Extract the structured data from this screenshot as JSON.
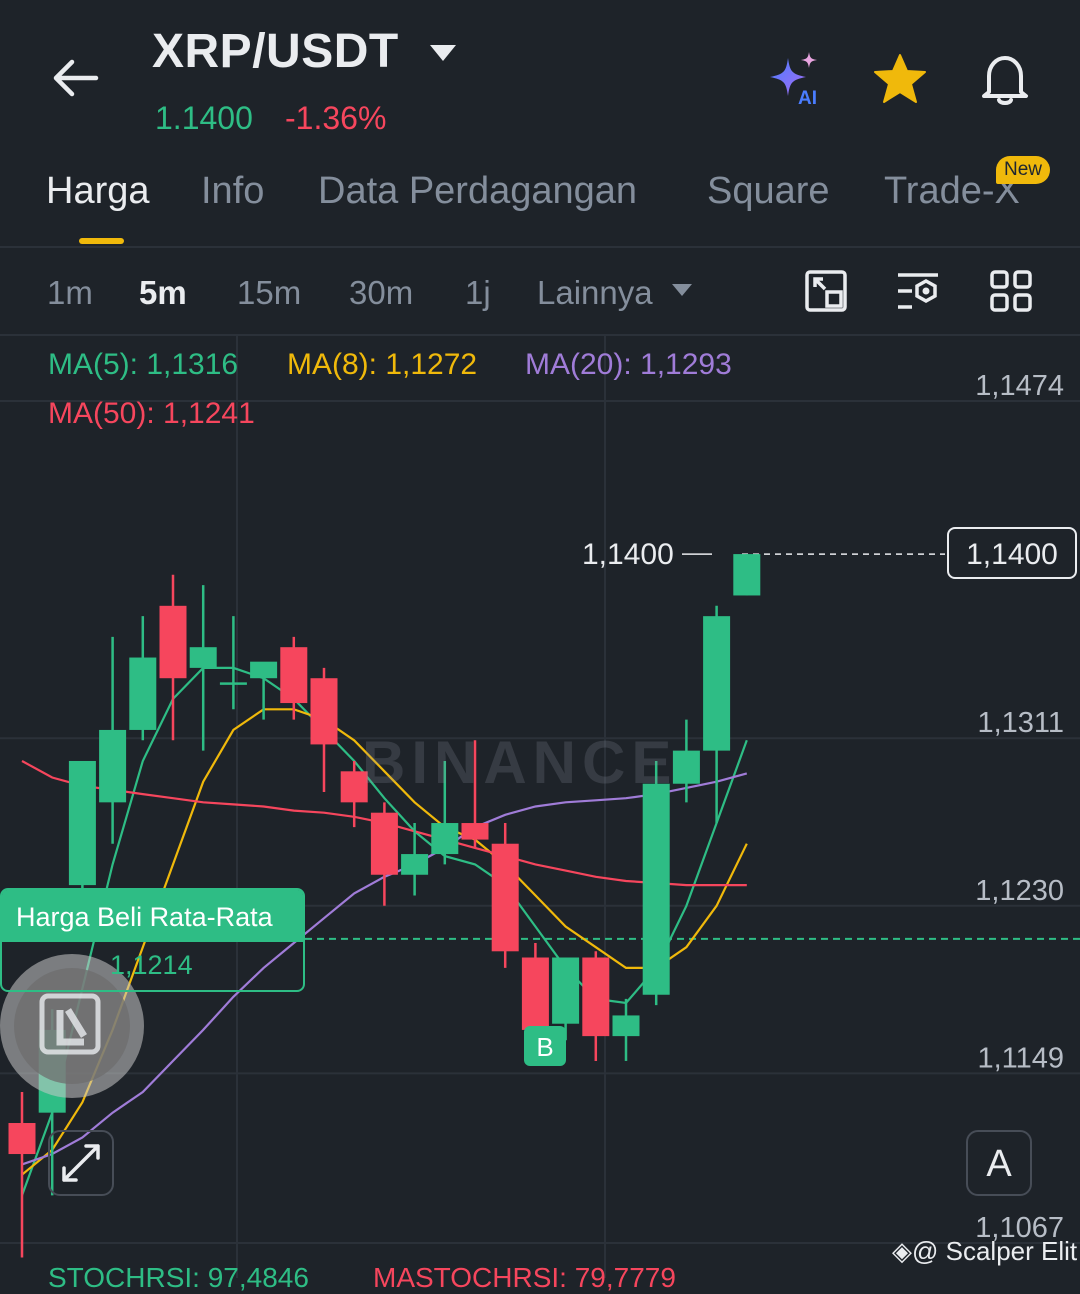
{
  "header": {
    "pair": "XRP/USDT",
    "price": "1.1400",
    "change": "-1.36%",
    "icons": [
      "back-arrow-icon",
      "ai-sparkle-icon",
      "star-icon",
      "bell-icon"
    ],
    "ai_label": "AI"
  },
  "tabs": [
    {
      "label": "Harga",
      "active": true
    },
    {
      "label": "Info",
      "active": false
    },
    {
      "label": "Data Perdagangan",
      "active": false
    },
    {
      "label": "Square",
      "active": false
    },
    {
      "label": "Trade-X",
      "active": false
    }
  ],
  "new_badge": "New",
  "intervals": [
    {
      "label": "1m",
      "active": false
    },
    {
      "label": "5m",
      "active": true
    },
    {
      "label": "15m",
      "active": false
    },
    {
      "label": "30m",
      "active": false
    },
    {
      "label": "1j",
      "active": false
    },
    {
      "label": "Lainnya",
      "active": false
    }
  ],
  "tools": [
    "chart-layout-icon",
    "indicator-settings-icon",
    "grid-view-icon"
  ],
  "ma_legend": [
    {
      "label": "MA(5): 1,1316",
      "color": "#2ebd85"
    },
    {
      "label": "MA(8): 1,1272",
      "color": "#f0b90b"
    },
    {
      "label": "MA(20): 1,1293",
      "color": "#a07cd8"
    },
    {
      "label": "MA(50): 1,1241",
      "color": "#f6465d"
    }
  ],
  "current_price_label": "1,1400",
  "average_buy": {
    "title": "Harga Beli Rata-Rata",
    "value": "1,1214"
  },
  "buy_marker": "B",
  "watermark": "BINANCE",
  "font_button": "A",
  "stoch": {
    "left": "STOCHRSI: 97,4846",
    "right": "MASTOCHRSI: 79,7779"
  },
  "credit": "@ Scalper Elit",
  "chart_data": {
    "type": "candlestick",
    "ylim": [
      1.103,
      1.153
    ],
    "y_ticks": [
      "1,1474",
      "1,1311",
      "1,1230",
      "1,1149",
      "1,1067"
    ],
    "y_tick_values": [
      1.1474,
      1.1311,
      1.123,
      1.1149,
      1.1067
    ],
    "last_price": 1.14,
    "avg_buy_price": 1.1214,
    "candles": [
      {
        "o": 1.1125,
        "h": 1.114,
        "l": 1.106,
        "c": 1.111
      },
      {
        "o": 1.113,
        "h": 1.118,
        "l": 1.109,
        "c": 1.117
      },
      {
        "o": 1.124,
        "h": 1.13,
        "l": 1.122,
        "c": 1.13
      },
      {
        "o": 1.128,
        "h": 1.136,
        "l": 1.126,
        "c": 1.1315
      },
      {
        "o": 1.1315,
        "h": 1.137,
        "l": 1.131,
        "c": 1.135
      },
      {
        "o": 1.1375,
        "h": 1.139,
        "l": 1.131,
        "c": 1.134
      },
      {
        "o": 1.1345,
        "h": 1.1385,
        "l": 1.1305,
        "c": 1.1355
      },
      {
        "o": 1.1338,
        "h": 1.137,
        "l": 1.1325,
        "c": 1.1338
      },
      {
        "o": 1.134,
        "h": 1.1345,
        "l": 1.132,
        "c": 1.1348
      },
      {
        "o": 1.1355,
        "h": 1.136,
        "l": 1.132,
        "c": 1.1328
      },
      {
        "o": 1.134,
        "h": 1.1345,
        "l": 1.1285,
        "c": 1.1308
      },
      {
        "o": 1.1295,
        "h": 1.13,
        "l": 1.1268,
        "c": 1.128
      },
      {
        "o": 1.1275,
        "h": 1.128,
        "l": 1.123,
        "c": 1.1245
      },
      {
        "o": 1.1245,
        "h": 1.127,
        "l": 1.1235,
        "c": 1.1255
      },
      {
        "o": 1.1255,
        "h": 1.13,
        "l": 1.125,
        "c": 1.127
      },
      {
        "o": 1.127,
        "h": 1.131,
        "l": 1.1258,
        "c": 1.1262
      },
      {
        "o": 1.126,
        "h": 1.127,
        "l": 1.12,
        "c": 1.1208
      },
      {
        "o": 1.1205,
        "h": 1.1212,
        "l": 1.1165,
        "c": 1.117
      },
      {
        "o": 1.1173,
        "h": 1.1205,
        "l": 1.1165,
        "c": 1.1205
      },
      {
        "o": 1.1205,
        "h": 1.1208,
        "l": 1.1155,
        "c": 1.1167
      },
      {
        "o": 1.1167,
        "h": 1.1185,
        "l": 1.1155,
        "c": 1.1177
      },
      {
        "o": 1.1187,
        "h": 1.13,
        "l": 1.1182,
        "c": 1.1289
      },
      {
        "o": 1.1289,
        "h": 1.132,
        "l": 1.128,
        "c": 1.1305
      },
      {
        "o": 1.1305,
        "h": 1.1375,
        "l": 1.127,
        "c": 1.137
      },
      {
        "o": 1.138,
        "h": 1.14,
        "l": 1.138,
        "c": 1.14
      }
    ],
    "ma_series": [
      {
        "label": "MA(5)",
        "color": "#2ebd85",
        "values": [
          1.109,
          1.113,
          1.119,
          1.125,
          1.13,
          1.133,
          1.1345,
          1.1345,
          1.134,
          1.133,
          1.1315,
          1.13,
          1.1282,
          1.1266,
          1.1254,
          1.125,
          1.124,
          1.122,
          1.12,
          1.1185,
          1.1183,
          1.12,
          1.123,
          1.127,
          1.131
        ]
      },
      {
        "label": "MA(8)",
        "color": "#f0b90b",
        "values": [
          1.11,
          1.1112,
          1.1135,
          1.117,
          1.121,
          1.125,
          1.129,
          1.1315,
          1.1325,
          1.1325,
          1.132,
          1.131,
          1.1295,
          1.128,
          1.1268,
          1.1262,
          1.125,
          1.1235,
          1.122,
          1.121,
          1.12,
          1.12,
          1.121,
          1.123,
          1.126
        ]
      },
      {
        "label": "MA(20)",
        "color": "#a07cd8",
        "values": [
          1.1105,
          1.111,
          1.1118,
          1.113,
          1.114,
          1.1155,
          1.117,
          1.1186,
          1.12,
          1.1212,
          1.1224,
          1.1236,
          1.1244,
          1.125,
          1.1258,
          1.1268,
          1.1274,
          1.1278,
          1.128,
          1.1281,
          1.1282,
          1.1284,
          1.1287,
          1.129,
          1.1294
        ]
      },
      {
        "label": "MA(50)",
        "color": "#f6465d",
        "values": [
          1.13,
          1.1292,
          1.1288,
          1.1286,
          1.1284,
          1.1282,
          1.128,
          1.1279,
          1.1278,
          1.1276,
          1.1275,
          1.1273,
          1.127,
          1.1266,
          1.1262,
          1.1258,
          1.1254,
          1.125,
          1.1247,
          1.1244,
          1.1242,
          1.1241,
          1.124,
          1.124,
          1.124
        ]
      }
    ]
  }
}
